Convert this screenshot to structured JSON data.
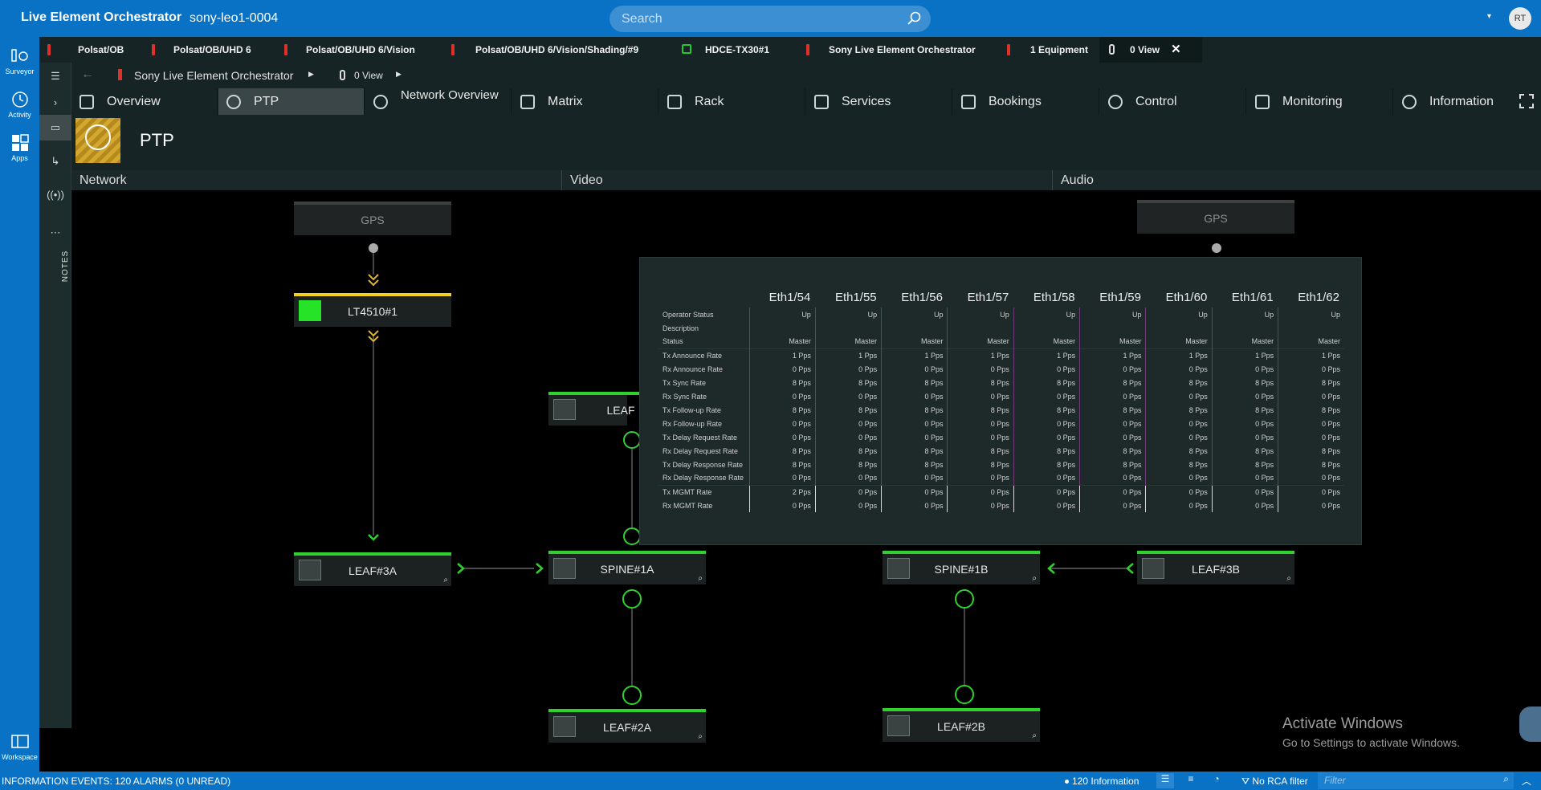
{
  "app": {
    "title": "Live Element Orchestrator",
    "server": "sony-leo1-0004",
    "search_placeholder": "Search",
    "avatar": "RT"
  },
  "rail": [
    {
      "label": "Surveyor",
      "icon": "surveyor-icon"
    },
    {
      "label": "Activity",
      "icon": "activity-icon"
    },
    {
      "label": "Apps",
      "icon": "apps-icon"
    },
    {
      "label": "Workspace",
      "icon": "workspace-icon"
    }
  ],
  "rail2": {
    "notes_label": "NOTES"
  },
  "tabs": [
    "Polsat/OB",
    "Polsat/OB/UHD 6",
    "Polsat/OB/UHD 6/Vision",
    "Polsat/OB/UHD 6/Vision/Shading/#9",
    "HDCE-TX30#1",
    "Sony Live Element Orchestrator",
    "1 Equipment",
    "0 View"
  ],
  "breadcrumb": [
    "Sony Live Element Orchestrator",
    "0 View"
  ],
  "nav": [
    "Overview",
    "PTP",
    "Network Overview",
    "Matrix",
    "Rack",
    "Services",
    "Bookings",
    "Control",
    "Monitoring",
    "Information"
  ],
  "page": {
    "title": "PTP"
  },
  "sections": [
    "Network",
    "Video",
    "Audio"
  ],
  "nodes": {
    "gps_left": "GPS",
    "gps_right": "GPS",
    "lt4510": "LT4510#1",
    "leaf3a": "LEAF#3A",
    "spine1a": "SPINE#1A",
    "spine1b": "SPINE#1B",
    "leaf3b": "LEAF#3B",
    "leaf2a": "LEAF#2A",
    "leaf2b": "LEAF#2B",
    "leaf_partial": "LEAF"
  },
  "ptp_table": {
    "columns": [
      "Eth1/54",
      "Eth1/55",
      "Eth1/56",
      "Eth1/57",
      "Eth1/58",
      "Eth1/59",
      "Eth1/60",
      "Eth1/61",
      "Eth1/62"
    ],
    "rows": [
      {
        "label": "Operator Status",
        "values": [
          "Up",
          "Up",
          "Up",
          "Up",
          "Up",
          "Up",
          "Up",
          "Up",
          "Up"
        ]
      },
      {
        "label": "Description",
        "values": [
          "",
          "",
          "",
          "",
          "",
          "",
          "",
          "",
          ""
        ]
      },
      {
        "label": "Status",
        "values": [
          "Master",
          "Master",
          "Master",
          "Master",
          "Master",
          "Master",
          "Master",
          "Master",
          "Master"
        ]
      },
      {
        "label": "Tx Announce Rate",
        "values": [
          "1 Pps",
          "1 Pps",
          "1 Pps",
          "1 Pps",
          "1 Pps",
          "1 Pps",
          "1 Pps",
          "1 Pps",
          "1 Pps"
        ]
      },
      {
        "label": "Rx Announce Rate",
        "values": [
          "0 Pps",
          "0 Pps",
          "0 Pps",
          "0 Pps",
          "0 Pps",
          "0 Pps",
          "0 Pps",
          "0 Pps",
          "0 Pps"
        ]
      },
      {
        "label": "Tx Sync Rate",
        "values": [
          "8 Pps",
          "8 Pps",
          "8 Pps",
          "8 Pps",
          "8 Pps",
          "8 Pps",
          "8 Pps",
          "8 Pps",
          "8 Pps"
        ]
      },
      {
        "label": "Rx Sync Rate",
        "values": [
          "0 Pps",
          "0 Pps",
          "0 Pps",
          "0 Pps",
          "0 Pps",
          "0 Pps",
          "0 Pps",
          "0 Pps",
          "0 Pps"
        ]
      },
      {
        "label": "Tx Follow-up Rate",
        "values": [
          "8 Pps",
          "8 Pps",
          "8 Pps",
          "8 Pps",
          "8 Pps",
          "8 Pps",
          "8 Pps",
          "8 Pps",
          "8 Pps"
        ]
      },
      {
        "label": "Rx Follow-up Rate",
        "values": [
          "0 Pps",
          "0 Pps",
          "0 Pps",
          "0 Pps",
          "0 Pps",
          "0 Pps",
          "0 Pps",
          "0 Pps",
          "0 Pps"
        ]
      },
      {
        "label": "Tx Delay Request Rate",
        "values": [
          "0 Pps",
          "0 Pps",
          "0 Pps",
          "0 Pps",
          "0 Pps",
          "0 Pps",
          "0 Pps",
          "0 Pps",
          "0 Pps"
        ]
      },
      {
        "label": "Rx Delay Request Rate",
        "values": [
          "8 Pps",
          "8 Pps",
          "8 Pps",
          "8 Pps",
          "8 Pps",
          "8 Pps",
          "8 Pps",
          "8 Pps",
          "8 Pps"
        ]
      },
      {
        "label": "Tx Delay Response Rate",
        "values": [
          "8 Pps",
          "8 Pps",
          "8 Pps",
          "8 Pps",
          "8 Pps",
          "8 Pps",
          "8 Pps",
          "8 Pps",
          "8 Pps"
        ]
      },
      {
        "label": "Rx Delay Response Rate",
        "values": [
          "0 Pps",
          "0 Pps",
          "0 Pps",
          "0 Pps",
          "0 Pps",
          "0 Pps",
          "0 Pps",
          "0 Pps",
          "0 Pps"
        ]
      },
      {
        "label": "Tx MGMT Rate",
        "values": [
          "2 Pps",
          "0 Pps",
          "0 Pps",
          "0 Pps",
          "0 Pps",
          "0 Pps",
          "0 Pps",
          "0 Pps",
          "0 Pps"
        ]
      },
      {
        "label": "Rx MGMT Rate",
        "values": [
          "0 Pps",
          "0 Pps",
          "0 Pps",
          "0 Pps",
          "0 Pps",
          "0 Pps",
          "0 Pps",
          "0 Pps",
          "0 Pps"
        ]
      }
    ]
  },
  "watermark": {
    "line1": "Activate Windows",
    "line2": "Go to Settings to activate Windows."
  },
  "status": {
    "events": "INFORMATION EVENTS: 120 ALARMS (0 UNREAD)",
    "info": "120 Information",
    "rca": "No RCA filter",
    "filter_placeholder": "Filter"
  },
  "colors": {
    "accent": "#0a72c4",
    "ok": "#2fd12f",
    "warn": "#f2d21c",
    "panel": "#172425"
  }
}
